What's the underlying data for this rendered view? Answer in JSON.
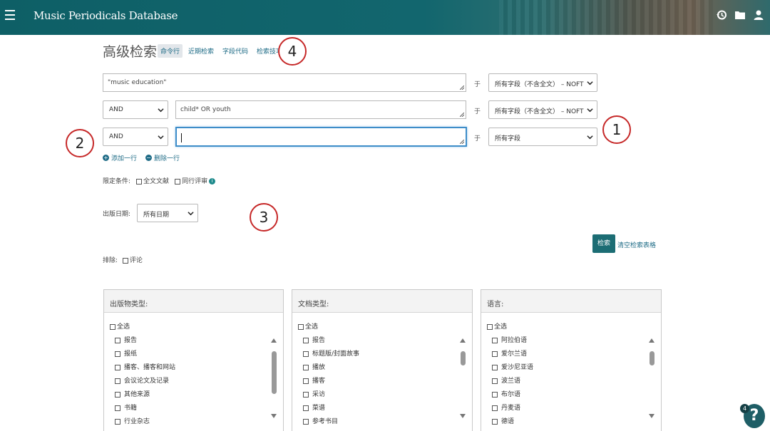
{
  "header": {
    "app_title": "Music Periodicals Database",
    "icons": [
      "menu-icon",
      "history-icon",
      "folder-icon",
      "user-icon"
    ],
    "accent_color": "#0e5f66"
  },
  "page": {
    "title": "高级检索",
    "tabs": [
      {
        "label": "命令行",
        "active": true
      },
      {
        "label": "近期检索",
        "active": false
      },
      {
        "label": "字段代码",
        "active": false
      },
      {
        "label": "检索技巧",
        "active": false
      }
    ]
  },
  "annotations": [
    "1",
    "2",
    "3",
    "4"
  ],
  "search_rows": [
    {
      "operator": "",
      "term": "\"music education\"",
      "in_label": "于",
      "field": "所有字段（不含全文） – NOFT"
    },
    {
      "operator": "AND",
      "term": "child* OR youth",
      "in_label": "于",
      "field": "所有字段（不含全文） – NOFT"
    },
    {
      "operator": "AND",
      "term": "",
      "in_label": "于",
      "field": "所有字段"
    }
  ],
  "row_ops": {
    "add": "添加一行",
    "remove": "删除一行"
  },
  "limits": {
    "label": "限定条件:",
    "options": [
      "全文文献",
      "同行评审"
    ]
  },
  "pub_date": {
    "label": "出版日期:",
    "value": "所有日期"
  },
  "actions": {
    "search": "检索",
    "clear": "清空检索表格"
  },
  "exclude": {
    "label": "排除:",
    "option": "评论"
  },
  "panels": [
    {
      "title": "出版物类型:",
      "select_all": "全选",
      "items": [
        "报告",
        "报纸",
        "播客、播客和网站",
        "会议论文及记录",
        "其他来源",
        "书籍",
        "行业杂志"
      ]
    },
    {
      "title": "文档类型:",
      "select_all": "全选",
      "items": [
        "报告",
        "标题版/封面故事",
        "播放",
        "播客",
        "采访",
        "菜谱",
        "参考书目"
      ]
    },
    {
      "title": "语言:",
      "select_all": "全选",
      "items": [
        "阿拉伯语",
        "爱尔兰语",
        "爱沙尼亚语",
        "波兰语",
        "布尔语",
        "丹麦语",
        "德语"
      ]
    }
  ],
  "help": {
    "label": "?",
    "badge": "4"
  }
}
